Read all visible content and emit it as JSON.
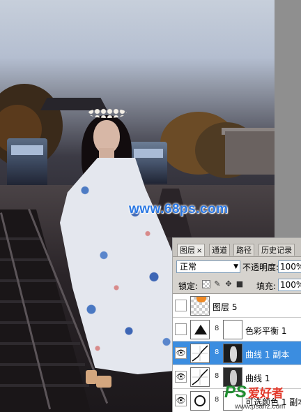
{
  "watermark": "www.68ps.com",
  "panel": {
    "tabs": [
      {
        "label": "图层",
        "active": true
      },
      {
        "label": "通道",
        "active": false
      },
      {
        "label": "路径",
        "active": false
      },
      {
        "label": "历史记录",
        "active": false
      }
    ],
    "close_glyph": "×",
    "blend_mode": "正常",
    "opacity_label": "不透明度:",
    "opacity_value": "100%",
    "lock_label": "锁定:",
    "fill_label": "填充:",
    "fill_value": "100%",
    "layers": [
      {
        "name": "图层 5",
        "visible": false,
        "selected": false,
        "has_mask": false
      },
      {
        "name": "色彩平衡 1",
        "visible": false,
        "selected": false,
        "has_mask": true
      },
      {
        "name": "曲线 1 副本",
        "visible": true,
        "selected": true,
        "has_mask": true
      },
      {
        "name": "曲线 1",
        "visible": true,
        "selected": false,
        "has_mask": true
      },
      {
        "name": "可选颜色 1 副本",
        "visible": true,
        "selected": false,
        "has_mask": true
      }
    ]
  },
  "branding": {
    "logo_text": "PS",
    "logo_cn": "爱好者",
    "url": "www.psahz.com"
  },
  "colors": {
    "selected_row": "#3b8de0",
    "watermark": "#2b78e4"
  }
}
